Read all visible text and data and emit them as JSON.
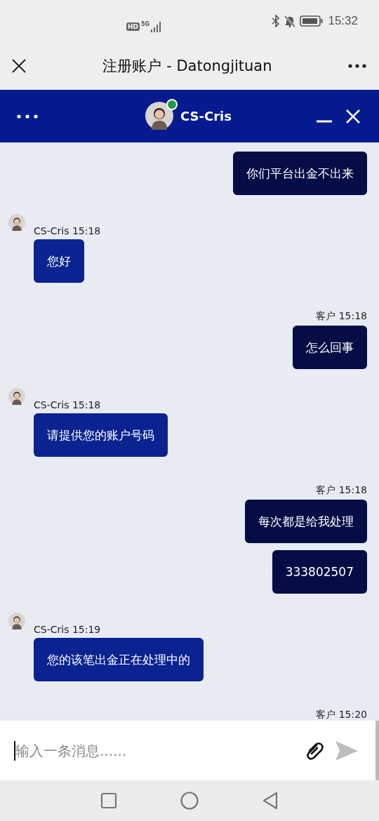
{
  "status_bar": {
    "hd": "HD",
    "network": "5G",
    "time": "15:32"
  },
  "title_bar": {
    "title": "注册账户 - Datongjituan"
  },
  "chat_header": {
    "agent_name": "CS-Cris",
    "online": true
  },
  "messages": [
    {
      "kind": "customer",
      "bubbles": [
        "你们平台出金不出来"
      ]
    },
    {
      "kind": "agent",
      "sender": "CS-Cris",
      "time": "15:18",
      "bubbles": [
        "您好"
      ]
    },
    {
      "kind": "customer",
      "sender": "客户",
      "time": "15:18",
      "bubbles": [
        "怎么回事"
      ]
    },
    {
      "kind": "agent",
      "sender": "CS-Cris",
      "time": "15:18",
      "bubbles": [
        "请提供您的账户号码"
      ]
    },
    {
      "kind": "customer",
      "sender": "客户",
      "time": "15:18",
      "bubbles": [
        "每次都是给我处理",
        "333802507"
      ]
    },
    {
      "kind": "agent",
      "sender": "CS-Cris",
      "time": "15:19",
      "bubbles": [
        "您的该笔出金正在处理中的"
      ]
    },
    {
      "kind": "customer",
      "sender": "客户",
      "time": "15:20"
    }
  ],
  "composer": {
    "placeholder": "输入一条消息......"
  }
}
